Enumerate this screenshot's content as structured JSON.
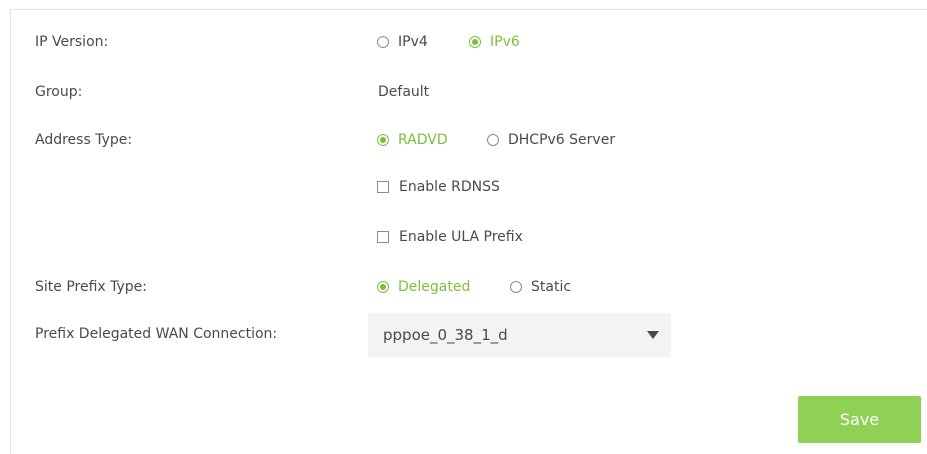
{
  "form": {
    "ip_version": {
      "label": "IP Version:",
      "options": [
        {
          "label": "IPv4",
          "selected": false
        },
        {
          "label": "IPv6",
          "selected": true
        }
      ]
    },
    "group": {
      "label": "Group:",
      "value": "Default"
    },
    "address_type": {
      "label": "Address Type:",
      "options": [
        {
          "label": "RADVD",
          "selected": true
        },
        {
          "label": "DHCPv6 Server",
          "selected": false
        }
      ],
      "checkboxes": [
        {
          "label": "Enable RDNSS",
          "checked": false
        },
        {
          "label": "Enable ULA Prefix",
          "checked": false
        }
      ]
    },
    "site_prefix_type": {
      "label": "Site Prefix Type:",
      "options": [
        {
          "label": "Delegated",
          "selected": true
        },
        {
          "label": "Static",
          "selected": false
        }
      ]
    },
    "prefix_wan": {
      "label": "Prefix Delegated WAN Connection:",
      "selected_value": "pppoe_0_38_1_d"
    }
  },
  "actions": {
    "save_label": "Save"
  },
  "colors": {
    "accent": "#7cbf3c",
    "save_button_bg": "#8fd155",
    "text": "#4a4a4a",
    "select_bg": "#f3f3f3"
  }
}
